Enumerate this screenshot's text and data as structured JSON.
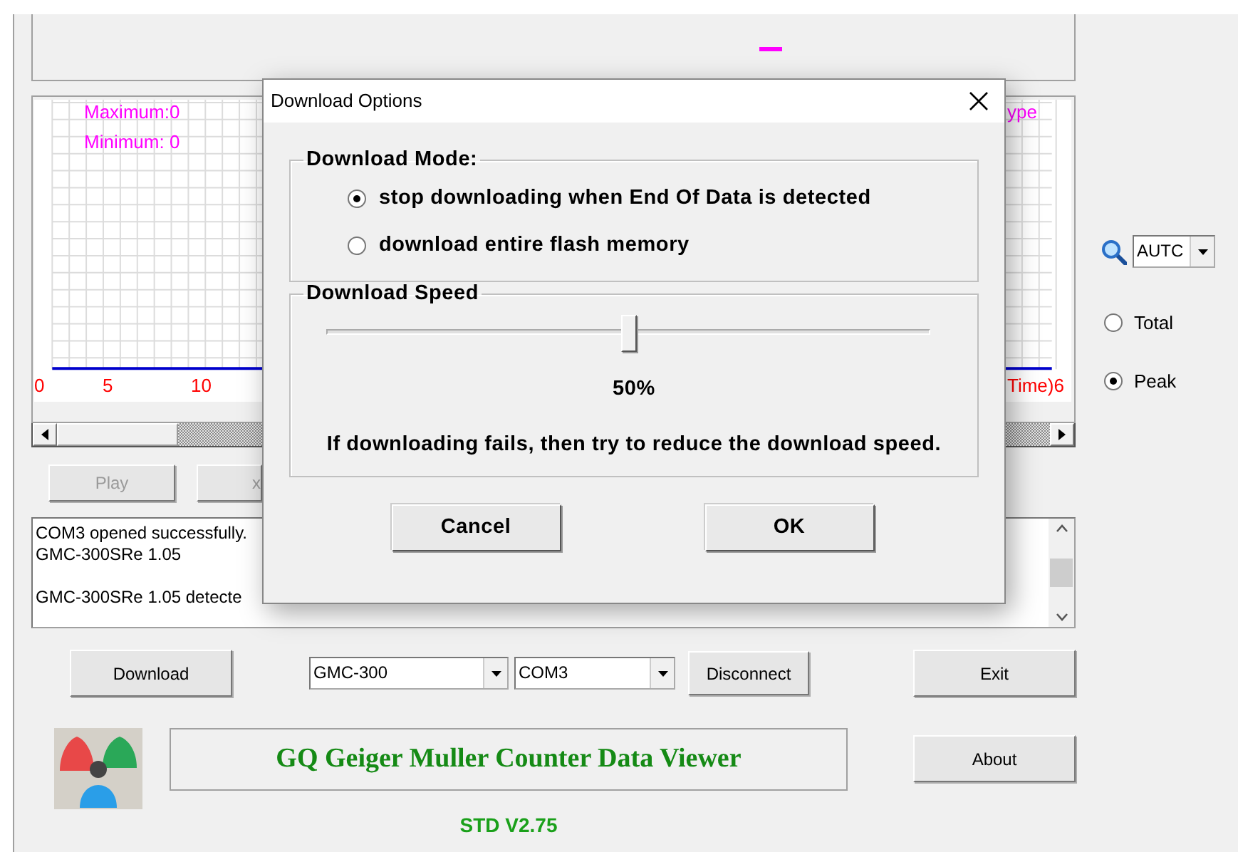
{
  "main_window": {
    "chart": {
      "max_label": "Maximum:0",
      "min_label": "Minimum: 0",
      "legend_label": "ype",
      "x_labels": [
        "0",
        "5",
        "10"
      ],
      "x_axis_end_label": "Time)6"
    },
    "playback_buttons": [
      {
        "label": "Play",
        "disabled": true
      },
      {
        "label": "x",
        "disabled": true
      }
    ],
    "log_blocks": [
      [
        "COM3 opened successfully.",
        "GMC-300SRe 1.05"
      ],
      [
        "GMC-300SRe 1.05 detecte"
      ]
    ],
    "download_button": "Download",
    "model_select": "GMC-300",
    "port_select": "COM3",
    "disconnect_button": "Disconnect",
    "exit_button": "Exit",
    "app_title": "GQ Geiger Muller Counter Data Viewer",
    "version": "STD V2.75",
    "about_button": "About",
    "zoom_select": "AUTC",
    "view_options": [
      {
        "label": "Total",
        "selected": false
      },
      {
        "label": "Peak",
        "selected": true
      }
    ]
  },
  "dialog": {
    "title": "Download Options",
    "mode_group": "Download Mode:",
    "modes": [
      {
        "label": "stop downloading when End Of Data is detected",
        "selected": true
      },
      {
        "label": "download entire flash memory",
        "selected": false
      }
    ],
    "speed_group": "Download Speed",
    "speed": {
      "level": 0.5,
      "reading": "50%"
    },
    "hint": "If downloading fails, then try to reduce the download speed.",
    "buttons": [
      "Cancel",
      "OK"
    ]
  }
}
